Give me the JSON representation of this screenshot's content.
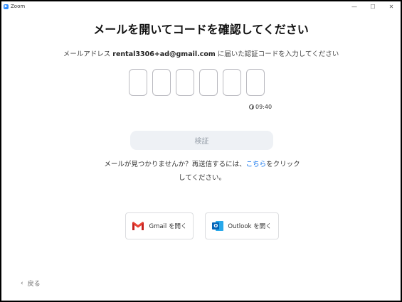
{
  "window": {
    "title": "Zoom",
    "controls": {
      "minimize": "—",
      "maximize": "☐",
      "close": "✕"
    }
  },
  "heading": "メールを開いてコードを確認してください",
  "instruction": {
    "prefix": "メールアドレス ",
    "email": "rental3306+ad@gmail.com",
    "suffix": " に届いた認証コードを入力してください"
  },
  "code_boxes": [
    "",
    "",
    "",
    "",
    "",
    ""
  ],
  "timer": "09:40",
  "verify_label": "検証",
  "help": {
    "before": "メールが見つかりませんか？再送信するには、",
    "link": "こちら",
    "after": "をクリックしてください。"
  },
  "gmail_label": "Gmail を開く",
  "outlook_label": "Outlook を開く",
  "outlook_letter": "O",
  "back_label": "戻る",
  "icons": {
    "app": "zoom-logo",
    "timer": "clock-icon",
    "gmail": "gmail-icon",
    "outlook": "outlook-icon",
    "back": "chevron-left-icon"
  },
  "colors": {
    "link": "#0e72ed",
    "verify_bg": "#eef1f5",
    "verify_text": "#98a0aa",
    "gmail_red": "#ea4335",
    "outlook_blue": "#0364b8"
  }
}
